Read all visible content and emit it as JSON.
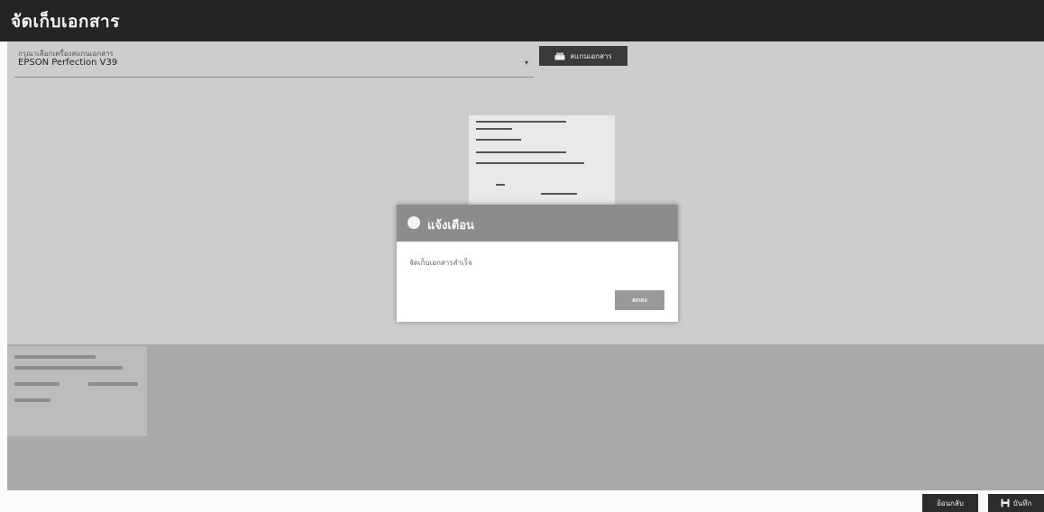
{
  "window": {
    "title": "จัดเก็บเอกสาร"
  },
  "scanner": {
    "label": "กรุณาเลือกเครื่องสแกนเอกสาร",
    "selected": "EPSON Perfection V39",
    "scan_button": "สแกนเอกสาร",
    "scan_icon": "scanner-icon"
  },
  "dialog": {
    "title": "แจ้งเตือน",
    "message": "จัดเก็บเอกสารสำเร็จ",
    "ok_label": "ตกลง",
    "icon": "info-icon"
  },
  "footer": {
    "back_label": "ย้อนกลับ",
    "save_label": "บันทึก",
    "save_icon": "save-icon"
  },
  "colors": {
    "titlebar": "#242424",
    "button_dark": "#2c2c2c",
    "dialog_header": "#8c8c8c",
    "overlay": "#cdcdcd"
  }
}
